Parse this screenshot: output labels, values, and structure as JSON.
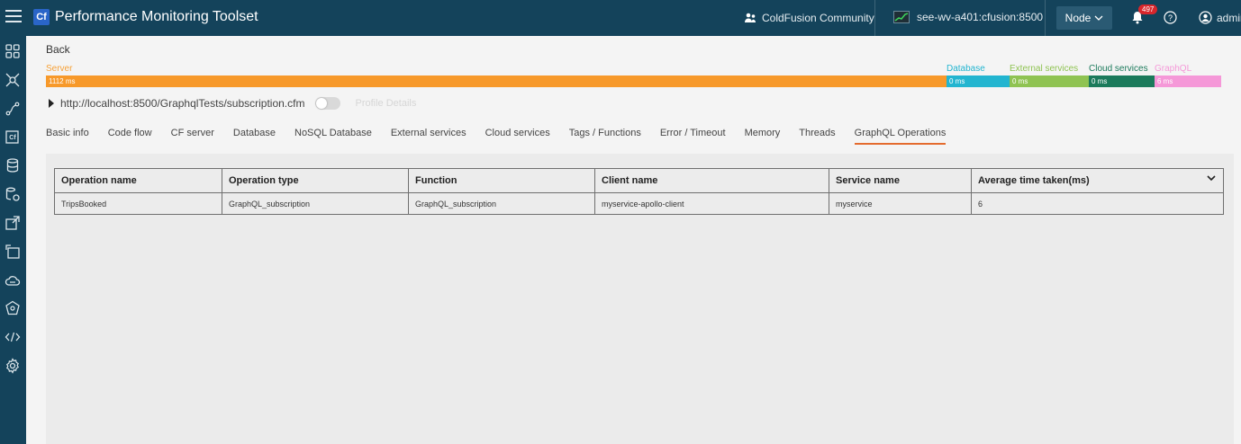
{
  "header": {
    "title": "Performance Monitoring Toolset",
    "logo": "Cf",
    "community": "ColdFusion Community",
    "server": "see-wv-a401:cfusion:8500",
    "node_label": "Node",
    "notifications": "497",
    "user": "admin"
  },
  "sidebar": {
    "icons": [
      "dashboard-icon",
      "topology-icon",
      "flow-icon",
      "cf-instance-icon",
      "database-icon",
      "datasource-icon",
      "external-icon",
      "export-icon",
      "cloud-icon",
      "network-icon",
      "code-icon",
      "settings-icon"
    ]
  },
  "page": {
    "back_label": "Back",
    "url": "http://localhost:8500/GraphqlTests/subscription.cfm",
    "toggle_label": "Profile Details"
  },
  "breakdown": {
    "legend": [
      {
        "label": "Server",
        "color": "#f7a239"
      },
      {
        "label": "Database",
        "color": "#22b5d0"
      },
      {
        "label": "External services",
        "color": "#8fc352"
      },
      {
        "label": "Cloud services",
        "color": "#1b7a5b"
      },
      {
        "label": "GraphQL",
        "color": "#f598d8"
      }
    ],
    "bars": [
      {
        "label": "1112 ms",
        "color": "#f7992a"
      },
      {
        "label": "0 ms",
        "color": "#22b5d0"
      },
      {
        "label": "0 ms",
        "color": "#8fc352"
      },
      {
        "label": "0 ms",
        "color": "#1b7a5b"
      },
      {
        "label": "6 ms",
        "color": "#f598d8"
      }
    ]
  },
  "tabs": [
    "Basic info",
    "Code flow",
    "CF server",
    "Database",
    "NoSQL Database",
    "External services",
    "Cloud services",
    "Tags / Functions",
    "Error / Timeout",
    "Memory",
    "Threads",
    "GraphQL Operations"
  ],
  "active_tab": "GraphQL Operations",
  "table": {
    "headers": [
      "Operation name",
      "Operation type",
      "Function",
      "Client name",
      "Service name",
      "Average time taken(ms)"
    ],
    "rows": [
      [
        "TripsBooked",
        "GraphQL_subscription",
        "GraphQL_subscription",
        "myservice-apollo-client",
        "myservice",
        "6"
      ]
    ]
  }
}
